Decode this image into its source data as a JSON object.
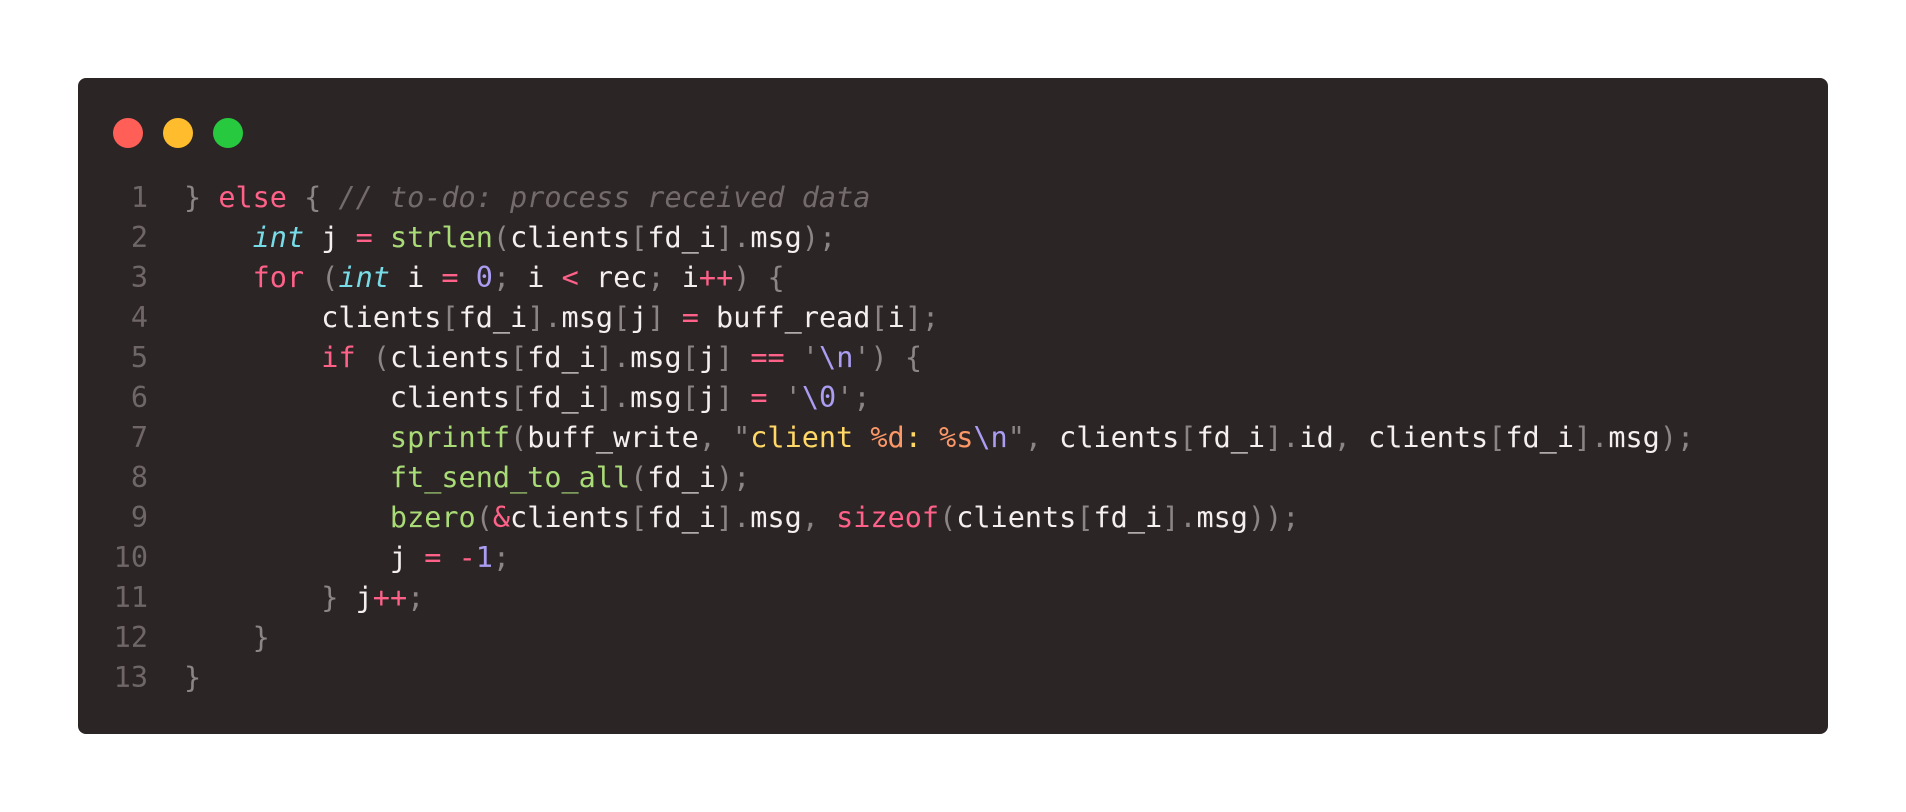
{
  "window": {
    "controls": [
      "close",
      "minimize",
      "maximize"
    ],
    "colors": {
      "background": "#2c2526",
      "close": "#ff5f56",
      "minimize": "#ffbd2e",
      "maximize": "#27c93f"
    }
  },
  "code": {
    "lines": [
      {
        "n": "1",
        "tokens": [
          {
            "c": "pu",
            "t": "} "
          },
          {
            "c": "kw",
            "t": "else"
          },
          {
            "c": "pu",
            "t": " { "
          },
          {
            "c": "cm",
            "t": "// to-do: process received data"
          }
        ]
      },
      {
        "n": "2",
        "tokens": [
          {
            "c": "tx",
            "t": "    "
          },
          {
            "c": "ty",
            "t": "int"
          },
          {
            "c": "tx",
            "t": " j "
          },
          {
            "c": "op",
            "t": "="
          },
          {
            "c": "tx",
            "t": " "
          },
          {
            "c": "fn",
            "t": "strlen"
          },
          {
            "c": "pu",
            "t": "("
          },
          {
            "c": "tx",
            "t": "clients"
          },
          {
            "c": "pu",
            "t": "["
          },
          {
            "c": "tx",
            "t": "fd_i"
          },
          {
            "c": "pu",
            "t": "]."
          },
          {
            "c": "tx",
            "t": "msg"
          },
          {
            "c": "pu",
            "t": ");"
          }
        ]
      },
      {
        "n": "3",
        "tokens": [
          {
            "c": "tx",
            "t": "    "
          },
          {
            "c": "kw",
            "t": "for"
          },
          {
            "c": "pu",
            "t": " ("
          },
          {
            "c": "ty",
            "t": "int"
          },
          {
            "c": "tx",
            "t": " i "
          },
          {
            "c": "op",
            "t": "="
          },
          {
            "c": "tx",
            "t": " "
          },
          {
            "c": "num",
            "t": "0"
          },
          {
            "c": "pu",
            "t": ";"
          },
          {
            "c": "tx",
            "t": " i "
          },
          {
            "c": "op",
            "t": "<"
          },
          {
            "c": "tx",
            "t": " rec"
          },
          {
            "c": "pu",
            "t": ";"
          },
          {
            "c": "tx",
            "t": " i"
          },
          {
            "c": "op",
            "t": "++"
          },
          {
            "c": "pu",
            "t": ") {"
          }
        ]
      },
      {
        "n": "4",
        "tokens": [
          {
            "c": "tx",
            "t": "        clients"
          },
          {
            "c": "pu",
            "t": "["
          },
          {
            "c": "tx",
            "t": "fd_i"
          },
          {
            "c": "pu",
            "t": "]."
          },
          {
            "c": "tx",
            "t": "msg"
          },
          {
            "c": "pu",
            "t": "["
          },
          {
            "c": "tx",
            "t": "j"
          },
          {
            "c": "pu",
            "t": "]"
          },
          {
            "c": "tx",
            "t": " "
          },
          {
            "c": "op",
            "t": "="
          },
          {
            "c": "tx",
            "t": " buff_read"
          },
          {
            "c": "pu",
            "t": "["
          },
          {
            "c": "tx",
            "t": "i"
          },
          {
            "c": "pu",
            "t": "];"
          }
        ]
      },
      {
        "n": "5",
        "tokens": [
          {
            "c": "tx",
            "t": "        "
          },
          {
            "c": "kw",
            "t": "if"
          },
          {
            "c": "pu",
            "t": " ("
          },
          {
            "c": "tx",
            "t": "clients"
          },
          {
            "c": "pu",
            "t": "["
          },
          {
            "c": "tx",
            "t": "fd_i"
          },
          {
            "c": "pu",
            "t": "]."
          },
          {
            "c": "tx",
            "t": "msg"
          },
          {
            "c": "pu",
            "t": "["
          },
          {
            "c": "tx",
            "t": "j"
          },
          {
            "c": "pu",
            "t": "]"
          },
          {
            "c": "tx",
            "t": " "
          },
          {
            "c": "op",
            "t": "=="
          },
          {
            "c": "tx",
            "t": " "
          },
          {
            "c": "pu",
            "t": "'"
          },
          {
            "c": "esc",
            "t": "\\n"
          },
          {
            "c": "pu",
            "t": "') {"
          }
        ]
      },
      {
        "n": "6",
        "tokens": [
          {
            "c": "tx",
            "t": "            clients"
          },
          {
            "c": "pu",
            "t": "["
          },
          {
            "c": "tx",
            "t": "fd_i"
          },
          {
            "c": "pu",
            "t": "]."
          },
          {
            "c": "tx",
            "t": "msg"
          },
          {
            "c": "pu",
            "t": "["
          },
          {
            "c": "tx",
            "t": "j"
          },
          {
            "c": "pu",
            "t": "]"
          },
          {
            "c": "tx",
            "t": " "
          },
          {
            "c": "op",
            "t": "="
          },
          {
            "c": "tx",
            "t": " "
          },
          {
            "c": "pu",
            "t": "'"
          },
          {
            "c": "esc",
            "t": "\\0"
          },
          {
            "c": "pu",
            "t": "';"
          }
        ]
      },
      {
        "n": "7",
        "tokens": [
          {
            "c": "tx",
            "t": "            "
          },
          {
            "c": "fn",
            "t": "sprintf"
          },
          {
            "c": "pu",
            "t": "("
          },
          {
            "c": "tx",
            "t": "buff_write"
          },
          {
            "c": "pu",
            "t": ", \""
          },
          {
            "c": "str",
            "t": "client "
          },
          {
            "c": "fmt",
            "t": "%d"
          },
          {
            "c": "str",
            "t": ": "
          },
          {
            "c": "fmt",
            "t": "%s"
          },
          {
            "c": "esc",
            "t": "\\n"
          },
          {
            "c": "pu",
            "t": "\", "
          },
          {
            "c": "tx",
            "t": "clients"
          },
          {
            "c": "pu",
            "t": "["
          },
          {
            "c": "tx",
            "t": "fd_i"
          },
          {
            "c": "pu",
            "t": "]."
          },
          {
            "c": "tx",
            "t": "id"
          },
          {
            "c": "pu",
            "t": ", "
          },
          {
            "c": "tx",
            "t": "clients"
          },
          {
            "c": "pu",
            "t": "["
          },
          {
            "c": "tx",
            "t": "fd_i"
          },
          {
            "c": "pu",
            "t": "]."
          },
          {
            "c": "tx",
            "t": "msg"
          },
          {
            "c": "pu",
            "t": ");"
          }
        ]
      },
      {
        "n": "8",
        "tokens": [
          {
            "c": "tx",
            "t": "            "
          },
          {
            "c": "fn",
            "t": "ft_send_to_all"
          },
          {
            "c": "pu",
            "t": "("
          },
          {
            "c": "tx",
            "t": "fd_i"
          },
          {
            "c": "pu",
            "t": ");"
          }
        ]
      },
      {
        "n": "9",
        "tokens": [
          {
            "c": "tx",
            "t": "            "
          },
          {
            "c": "fn",
            "t": "bzero"
          },
          {
            "c": "pu",
            "t": "("
          },
          {
            "c": "op",
            "t": "&"
          },
          {
            "c": "tx",
            "t": "clients"
          },
          {
            "c": "pu",
            "t": "["
          },
          {
            "c": "tx",
            "t": "fd_i"
          },
          {
            "c": "pu",
            "t": "]."
          },
          {
            "c": "tx",
            "t": "msg"
          },
          {
            "c": "pu",
            "t": ", "
          },
          {
            "c": "kw",
            "t": "sizeof"
          },
          {
            "c": "pu",
            "t": "("
          },
          {
            "c": "tx",
            "t": "clients"
          },
          {
            "c": "pu",
            "t": "["
          },
          {
            "c": "tx",
            "t": "fd_i"
          },
          {
            "c": "pu",
            "t": "]."
          },
          {
            "c": "tx",
            "t": "msg"
          },
          {
            "c": "pu",
            "t": "));"
          }
        ]
      },
      {
        "n": "10",
        "tokens": [
          {
            "c": "tx",
            "t": "            j "
          },
          {
            "c": "op",
            "t": "="
          },
          {
            "c": "tx",
            "t": " "
          },
          {
            "c": "op",
            "t": "-"
          },
          {
            "c": "num",
            "t": "1"
          },
          {
            "c": "pu",
            "t": ";"
          }
        ]
      },
      {
        "n": "11",
        "tokens": [
          {
            "c": "tx",
            "t": "        "
          },
          {
            "c": "pu",
            "t": "}"
          },
          {
            "c": "tx",
            "t": " j"
          },
          {
            "c": "op",
            "t": "++"
          },
          {
            "c": "pu",
            "t": ";"
          }
        ]
      },
      {
        "n": "12",
        "tokens": [
          {
            "c": "tx",
            "t": "    "
          },
          {
            "c": "pu",
            "t": "}"
          }
        ]
      },
      {
        "n": "13",
        "tokens": [
          {
            "c": "pu",
            "t": "}"
          }
        ]
      }
    ]
  }
}
